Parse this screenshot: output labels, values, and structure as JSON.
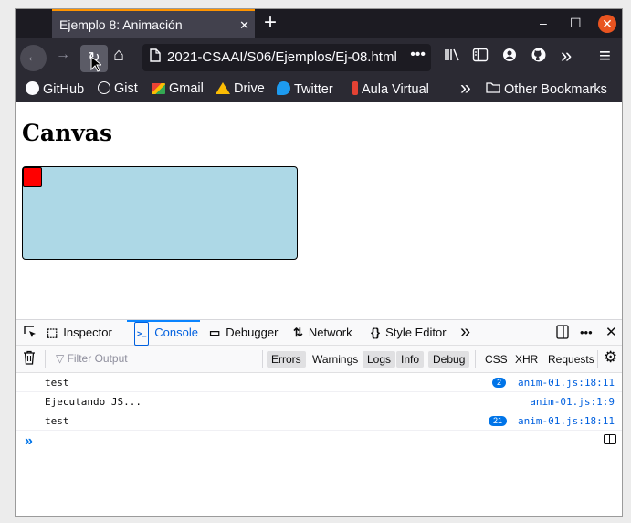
{
  "browser": {
    "tab": {
      "title": "Ejemplo 8: Animación",
      "close_glyph": "✕"
    },
    "new_tab_glyph": "+",
    "window_controls": {
      "minimize": "–",
      "maximize": "☐",
      "close": "✕"
    },
    "nav": {
      "back_glyph": "←",
      "forward_glyph": "→",
      "reload_glyph": "↻",
      "home_glyph": "⌂",
      "url": "2021-CSAAI/S06/Ejemplos/Ej-08.html",
      "url_menu_glyph": "•••",
      "toolbar_icons": [
        "library-icon",
        "sidebar-icon",
        "account-icon",
        "github-extension-icon",
        "overflow-icon",
        "menu-icon"
      ],
      "library_glyph": "𝄃\\",
      "sidebar_glyph": "▥",
      "account_glyph": "◉",
      "github_glyph": "◍",
      "overflow_glyph": "»",
      "menu_glyph": "≡"
    },
    "bookmarks": {
      "items": [
        {
          "label": "GitHub",
          "icon": "github-icon"
        },
        {
          "label": "Gist",
          "icon": "globe-icon"
        },
        {
          "label": "Gmail",
          "icon": "gmail-icon"
        },
        {
          "label": "Drive",
          "icon": "drive-icon"
        },
        {
          "label": "Twitter",
          "icon": "twitter-icon"
        },
        {
          "label": "Aula Virtual",
          "icon": "bookmark-icon"
        }
      ],
      "overflow_glyph": "»",
      "other": "Other Bookmarks"
    }
  },
  "page": {
    "heading": "Canvas",
    "canvas_color": "#add8e6",
    "sprite_color": "#ff0000"
  },
  "devtools": {
    "tabs": [
      {
        "label": "Inspector",
        "icon": "inspector-icon"
      },
      {
        "label": "Console",
        "icon": "console-icon",
        "selected": true
      },
      {
        "label": "Debugger",
        "icon": "debugger-icon"
      },
      {
        "label": "Network",
        "icon": "network-icon"
      },
      {
        "label": "Style Editor",
        "icon": "style-editor-icon"
      }
    ],
    "overflow_glyph": "»",
    "more_glyph": "•••",
    "close_glyph": "✕",
    "filter": {
      "placeholder": "Filter Output",
      "levels": [
        {
          "label": "Errors",
          "active": true
        },
        {
          "label": "Warnings",
          "active": false
        },
        {
          "label": "Logs",
          "active": true
        },
        {
          "label": "Info",
          "active": true
        },
        {
          "label": "Debug",
          "active": true
        }
      ],
      "types": [
        "CSS",
        "XHR",
        "Requests"
      ]
    },
    "console": {
      "messages": [
        {
          "text": "test",
          "count": "2",
          "source": "anim-01.js:18:11"
        },
        {
          "text": "Ejecutando JS...",
          "count": "",
          "source": "anim-01.js:1:9"
        },
        {
          "text": "test",
          "count": "21",
          "source": "anim-01.js:18:11"
        }
      ],
      "prompt_glyph": "»"
    }
  }
}
